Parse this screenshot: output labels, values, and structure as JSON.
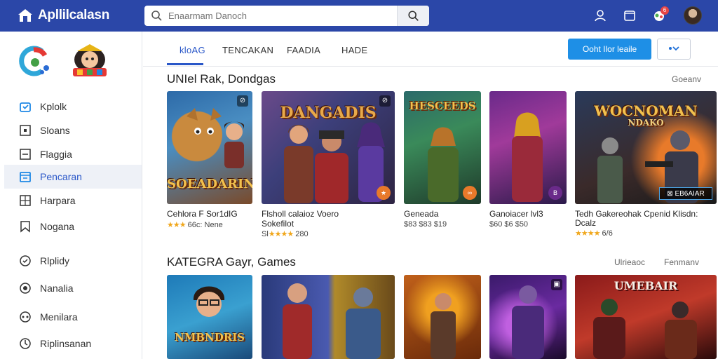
{
  "app": {
    "title": "Apllilcalasn"
  },
  "search": {
    "placeholder": "Enaarmam Danoch"
  },
  "header": {
    "notification_count": "6"
  },
  "sidebar": {
    "items": [
      {
        "label": "Kplolk",
        "icon": "bag-icon"
      },
      {
        "label": "Sloans",
        "icon": "square-icon"
      },
      {
        "label": "Flaggia",
        "icon": "flag-box-icon"
      },
      {
        "label": "Pencaran",
        "icon": "folder-icon",
        "active": true
      },
      {
        "label": "Harpara",
        "icon": "grid-icon"
      },
      {
        "label": "Nogana",
        "icon": "bookmark-icon"
      },
      {
        "label": "Rlplidy",
        "icon": "circle-check-icon"
      },
      {
        "label": "Nanalia",
        "icon": "badge-icon"
      },
      {
        "label": "Menilara",
        "icon": "puzzle-icon"
      },
      {
        "label": "Riplinsanan",
        "icon": "shield-icon"
      }
    ]
  },
  "tabs": [
    {
      "label": "kloAG",
      "active": true
    },
    {
      "label": "TENCAKAN"
    },
    {
      "label": "FAADIA"
    },
    {
      "label": "HADE"
    }
  ],
  "actions": {
    "primary": "Ooht Ilor leaile"
  },
  "section1": {
    "title": "UNIel Rak, Dondgas",
    "link": "Goeanv",
    "cards": [
      {
        "art_title": "SOEADARIN",
        "title": "Cehlora F Sor1dIG",
        "rating": "★★★",
        "meta": "66c: Nene"
      },
      {
        "art_title": "DANGADIS",
        "title": "Flsholl calaioz Voero",
        "title2": "Sokefilot",
        "rating": "★★★★",
        "rating_prefix": "Sl",
        "meta": "280"
      },
      {
        "art_title": "HESCEEDS",
        "title": "Geneada",
        "meta": "$83 $83 $19"
      },
      {
        "art_title": "",
        "title": "Ganoiacer lvl3",
        "meta": "$60 $6 $50"
      },
      {
        "art_title": "WOCNOMAN",
        "art_sub": "NDAKO",
        "title": "Tedh Gakereohak Cpenid Klisdn:",
        "title2": "Dcalz",
        "rating": "★★★★",
        "meta": "6/6"
      }
    ]
  },
  "section2": {
    "title": "KATEGRA Gayr, Games",
    "link1": "Ulrieaoc",
    "link2": "Fenmanv",
    "cards": [
      {
        "art_title": "NMBNDRIS"
      },
      {
        "art_title": ""
      },
      {
        "art_title": ""
      },
      {
        "art_title": ""
      },
      {
        "art_title": "UMEBAIR"
      }
    ]
  },
  "colors": {
    "header": "#2b47a8",
    "accent": "#2a57c8",
    "primary_button": "#1e8fe6",
    "star": "#f0a71c"
  }
}
